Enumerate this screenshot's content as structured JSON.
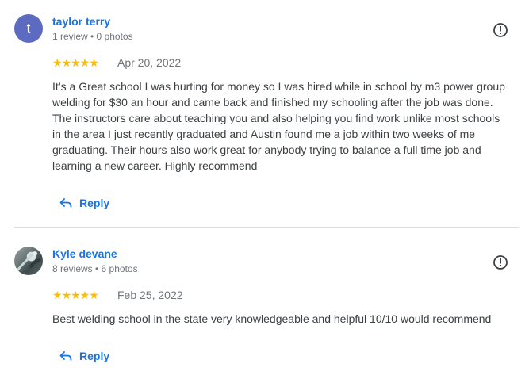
{
  "reviews": [
    {
      "avatar_letter": "t",
      "name": "taylor terry",
      "meta": "1 review • 0 photos",
      "rating": 5,
      "date": "Apr 20, 2022",
      "text_lines": [
        "It’s a Great school I was hurting for money so I was hired while in school by m3 power group",
        "welding for $30 an hour and came back and finished my schooling after the job was done.",
        "The instructors care about teaching you and also helping you find work unlike most schools",
        "in the area I just recently graduated and Austin found me a job within two weeks of me",
        "graduating. Their hours also work great for anybody trying to balance a full time job and",
        "learning a new career. Highly recommend"
      ],
      "reply_label": "Reply"
    },
    {
      "name": "Kyle devane",
      "meta": "8 reviews • 6 photos",
      "rating": 5,
      "date": "Feb 25, 2022",
      "text_lines": [
        "Best welding school in the state very knowledgeable and helpful 10/10 would recommend"
      ],
      "reply_label": "Reply"
    }
  ],
  "colors": {
    "link": "#1a73e8",
    "star": "#fbbc04",
    "avatar": "#5c6bc0",
    "secondary": "#70757a"
  },
  "icons": {
    "flag": "report-flag-icon",
    "reply": "reply-arrow-icon",
    "star": "star-icon"
  }
}
